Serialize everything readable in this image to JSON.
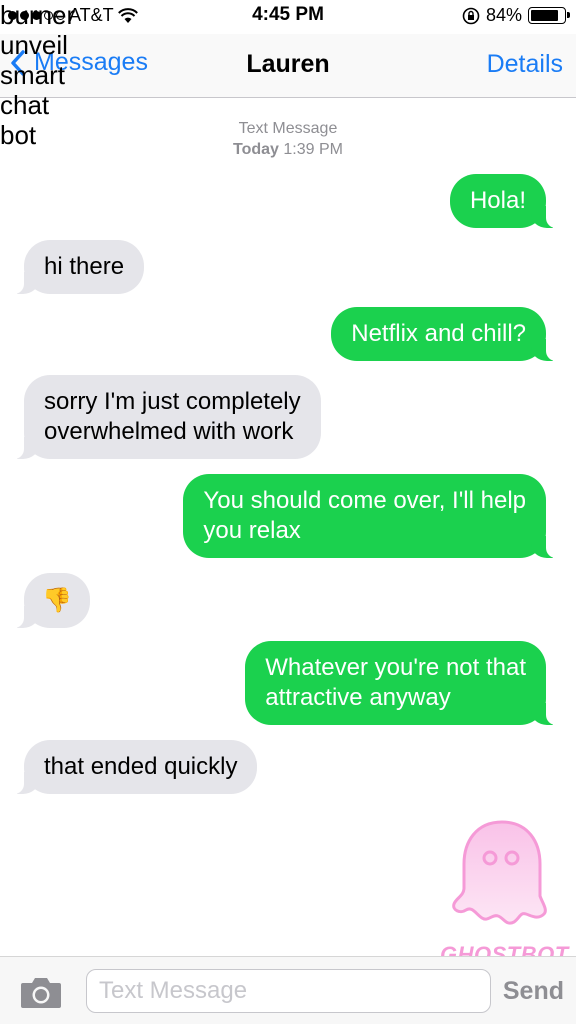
{
  "overlay_text": [
    "burner",
    "unveil",
    "smart",
    "chat",
    "bot"
  ],
  "status_bar": {
    "carrier": "AT&T",
    "time": "4:45 PM",
    "battery_percent": "84%",
    "battery_level": 0.84
  },
  "nav": {
    "back_label": "Messages",
    "title": "Lauren",
    "details_label": "Details"
  },
  "thread_header": {
    "service": "Text Message",
    "day": "Today",
    "time": "1:39 PM"
  },
  "messages": [
    {
      "direction": "out",
      "text": "Hola!"
    },
    {
      "direction": "in",
      "text": "hi there"
    },
    {
      "direction": "out",
      "text": "Netflix and chill?"
    },
    {
      "direction": "in",
      "line1": "sorry I'm just completely",
      "line2": "overwhelmed with work"
    },
    {
      "direction": "out",
      "line1": "You should come over, I'll help",
      "line2": "you relax"
    },
    {
      "direction": "in",
      "text": "👎"
    },
    {
      "direction": "out",
      "line1": "Whatever you're not that",
      "line2": "attractive anyway"
    },
    {
      "direction": "in",
      "text": "that ended quickly"
    }
  ],
  "watermark": {
    "label": "GHOSTBOT",
    "icon": "ghost-icon",
    "color": "#f59ad7"
  },
  "input_bar": {
    "placeholder": "Text Message",
    "send_label": "Send"
  },
  "colors": {
    "outgoing_bubble": "#1bd14e",
    "incoming_bubble": "#e5e5ea",
    "ios_blue": "#1a7cf5"
  }
}
